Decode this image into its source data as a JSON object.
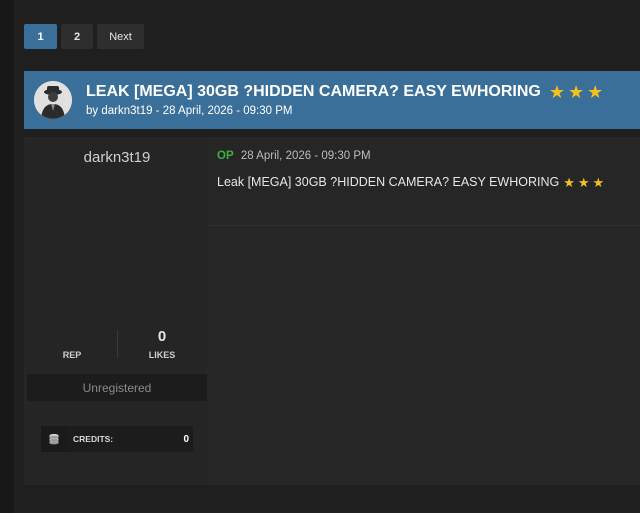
{
  "pagination": {
    "pages": [
      "1",
      "2"
    ],
    "current": "1",
    "next_label": "Next"
  },
  "thread": {
    "title": "LEAK [MEGA] 30GB ?HIDDEN CAMERA? EASY EWHORING",
    "byline": "by darkn3t19 - 28 April, 2026 - 09:30 PM",
    "rating_stars": 3
  },
  "post": {
    "author": {
      "username": "darkn3t19",
      "rep_label": "REP",
      "rep_value": "",
      "likes_label": "LIKES",
      "likes_value": "0",
      "user_group": "Unregistered",
      "credits_label": "CREDITS:",
      "credits_value": "0"
    },
    "op_tag": "OP",
    "timestamp": "28 April, 2026 - 09:30 PM",
    "content": "Leak [MEGA] 30GB ?HIDDEN CAMERA? EASY EWHORING"
  },
  "colors": {
    "accent": "#3a6f99",
    "star": "#f3c21b",
    "op_green": "#3cb043"
  },
  "icons": [
    "star-icon",
    "coins-icon",
    "avatar-image"
  ]
}
